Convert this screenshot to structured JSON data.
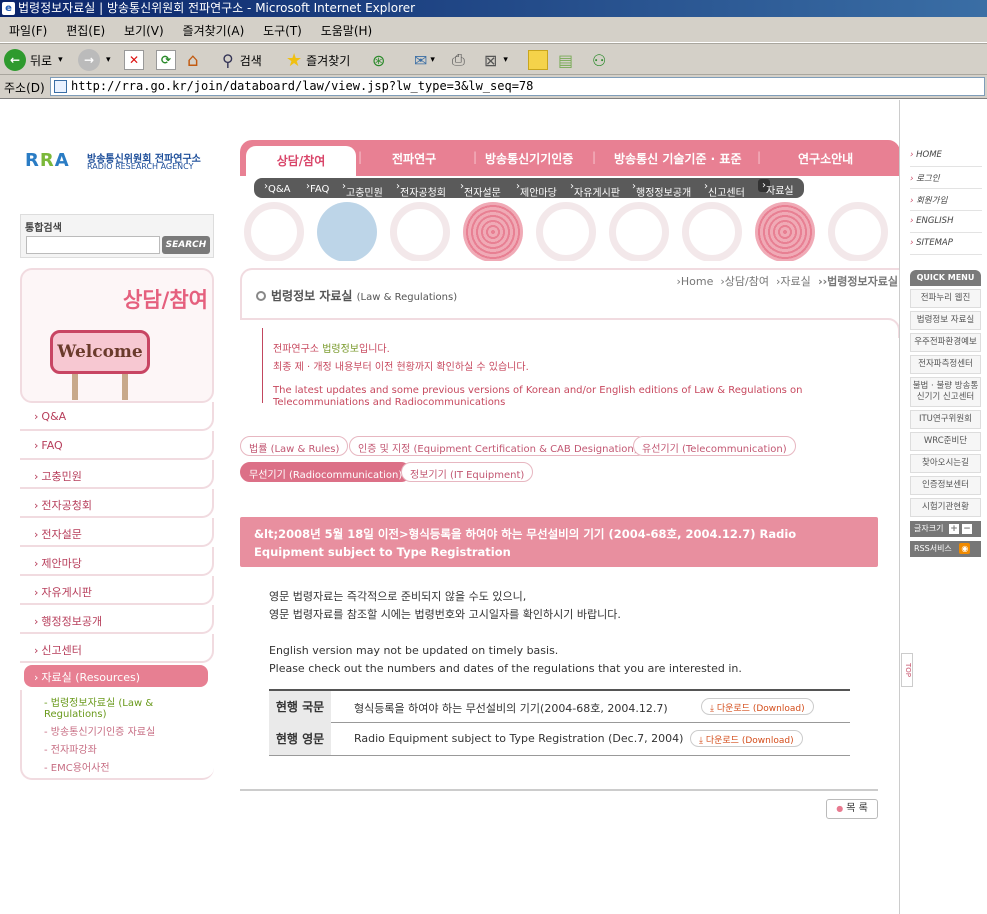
{
  "window": {
    "title": "법령정보자료실 | 방송통신위원회 전파연구소 - Microsoft Internet Explorer"
  },
  "menubar": [
    "파일(F)",
    "편집(E)",
    "보기(V)",
    "즐겨찾기(A)",
    "도구(T)",
    "도움말(H)"
  ],
  "toolbar": {
    "back": "뒤로",
    "search": "검색",
    "favorites": "즐겨찾기"
  },
  "address": {
    "label": "주소(D)",
    "url": "http://rra.go.kr/join/databoard/law/view.jsp?lw_type=3&lw_seq=78"
  },
  "logo": {
    "mark": "RRA",
    "org_ko": "방송통신위원회 전파연구소",
    "org_en": "RADIO RESEARCH AGENCY"
  },
  "search": {
    "label": "통합검색",
    "button": "SEARCH"
  },
  "banner": {
    "title": "상담/참여",
    "sign": "Welcome"
  },
  "left_menu": [
    "Q&A",
    "FAQ",
    "고충민원",
    "전자공청회",
    "전자설문",
    "제안마당",
    "자유게시판",
    "행정정보공개",
    "신고센터",
    "자료실 (Resources)"
  ],
  "left_sub": [
    "- 법령정보자료실 (Law & Regulations)",
    "- 방송통신기기인증 자료실",
    "- 전자파강좌",
    "- EMC용어사전"
  ],
  "gnb": [
    "상담/참여",
    "전파연구",
    "방송통신기기인증",
    "방송통신 기술기준 · 표준",
    "연구소안내"
  ],
  "lnb": [
    "Q&A",
    "FAQ",
    "고충민원",
    "전자공청회",
    "전자설문",
    "제안마당",
    "자유게시판",
    "행정정보공개",
    "신고센터",
    "자료실"
  ],
  "page_title": {
    "ko": "법령정보 자료실",
    "en": "(Law & Regulations)"
  },
  "breadcrumb": [
    "Home",
    "상담/참여",
    "자료실",
    "법령정보자료실"
  ],
  "intro": {
    "line1_pre": "전파연구소 ",
    "line1_hl": "법령정보",
    "line1_post": "입니다.",
    "line2": "최종 제 · 개정 내용부터 이전 현황까지 확인하실 수 있습니다.",
    "line3": "The latest updates and some previous versions of Korean and/or English editions of Law & Regulations on Telecommuniations and Radiocommunications"
  },
  "categories": [
    "법률 (Law & Rules)",
    "인증 및 지정 (Equipment Certification & CAB Designation)",
    "유선기기 (Telecommunication)",
    "무선기기 (Radiocommunication)",
    "정보기기 (IT Equipment)"
  ],
  "doc_title": "&lt;2008년 5월 18일 이전>형식등록을 하여야 하는 무선설비의 기기 (2004-68호, 2004.12.7) Radio Equipment subject to Type Registration",
  "notice": {
    "ko1": "영문 법령자료는 즉각적으로 준비되지 않을 수도 있으니,",
    "ko2": "영문 법령자료를 참조할 시에는 법령번호와 고시일자를 확인하시기 바랍니다.",
    "en1": "English version may not be updated on timely basis.",
    "en2": "Please check out the numbers and dates of the regulations that you are interested in."
  },
  "files": [
    {
      "head": "현행 국문",
      "title": "형식등록을 하여야 하는 무선설비의 기기(2004-68호, 2004.12.7)",
      "download": "다운로드 (Download)"
    },
    {
      "head": "현행 영문",
      "title": "Radio Equipment subject to Type Registration (Dec.7, 2004)",
      "download": "다운로드 (Download)"
    }
  ],
  "list_button": "목 록",
  "top_button": "TOP",
  "util_links": [
    "HOME",
    "로그인",
    "회원가입",
    "ENGLISH",
    "SITEMAP"
  ],
  "quick_menu": {
    "head": "QUICK MENU",
    "items": [
      "전파누리 웹진",
      "법령정보 자료실",
      "우주전파환경예보",
      "전자파측정센터",
      "불법 · 불량 방송통신기기 신고센터",
      "ITU연구위원회",
      "WRC준비단",
      "찾아오시는길",
      "인증정보센터",
      "시험기관현황"
    ],
    "font_size": "글자크기",
    "rss": "RSS서비스"
  },
  "colors": {
    "brand_pink": "#e88093",
    "title_bar": "#0a246a"
  }
}
